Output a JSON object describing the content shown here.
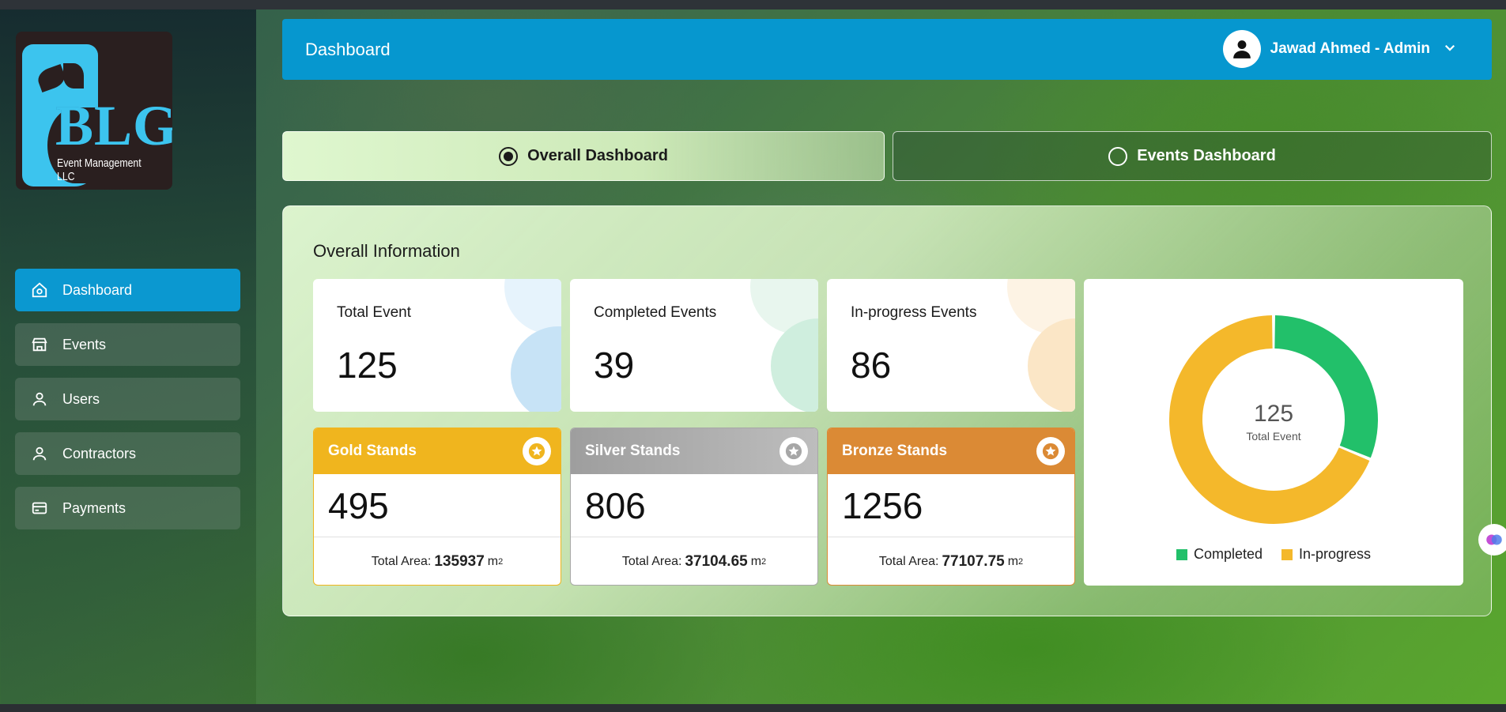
{
  "brand": {
    "logo_letters": "BLG",
    "logo_subtitle": "Event Management LLC"
  },
  "sidebar": {
    "items": [
      {
        "label": "Dashboard",
        "icon": "home-icon",
        "active": true
      },
      {
        "label": "Events",
        "icon": "store-icon",
        "active": false
      },
      {
        "label": "Users",
        "icon": "user-icon",
        "active": false
      },
      {
        "label": "Contractors",
        "icon": "user-icon",
        "active": false
      },
      {
        "label": "Payments",
        "icon": "credit-card-icon",
        "active": false
      }
    ]
  },
  "header": {
    "title": "Dashboard",
    "user_name": "Jawad Ahmed - Admin"
  },
  "toggles": {
    "overall_label": "Overall Dashboard",
    "events_label": "Events Dashboard",
    "selected": "overall"
  },
  "overview": {
    "title": "Overall Information",
    "stats": [
      {
        "label": "Total Event",
        "value": "125"
      },
      {
        "label": "Completed Events",
        "value": "39"
      },
      {
        "label": "In-progress Events",
        "value": "86"
      }
    ],
    "stands": [
      {
        "label": "Gold Stands",
        "value": "495",
        "area_prefix": "Total Area:",
        "area": "135937",
        "unit": "m",
        "unit_sup": "2",
        "color": "#f0b51e"
      },
      {
        "label": "Silver Stands",
        "value": "806",
        "area_prefix": "Total Area:",
        "area": "37104.65",
        "unit": "m",
        "unit_sup": "2",
        "color": "#a7a7a7"
      },
      {
        "label": "Bronze Stands",
        "value": "1256",
        "area_prefix": "Total Area:",
        "area": "77107.75",
        "unit": "m",
        "unit_sup": "2",
        "color": "#db8a35"
      }
    ]
  },
  "chart_data": {
    "type": "pie",
    "categories": [
      "Completed",
      "In-progress"
    ],
    "values": [
      39,
      86
    ],
    "colors": [
      "#22c06a",
      "#f4b82b"
    ],
    "center_value": "125",
    "center_label": "Total Event",
    "legend_placement": "bottom"
  },
  "colors": {
    "accent": "#0697cf",
    "completed": "#22c06a",
    "in_progress": "#f4b82b"
  }
}
